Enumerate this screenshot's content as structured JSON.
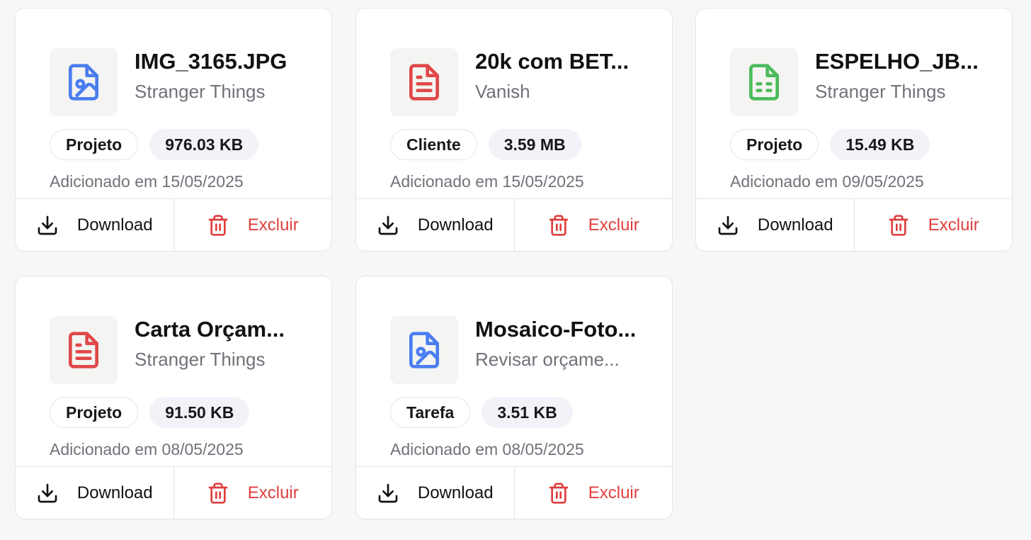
{
  "colors": {
    "image_icon": "#4a7ef0",
    "doc_icon": "#e04848",
    "sheet_icon": "#4cbb5c",
    "delete": "#e03e3e"
  },
  "labels": {
    "download": "Download",
    "delete": "Excluir"
  },
  "files": [
    {
      "icon": "image-file-icon",
      "name": "IMG_3165.JPG",
      "subtitle": "Stranger Things",
      "type": "Projeto",
      "size": "976.03 KB",
      "added": "Adicionado em 15/05/2025"
    },
    {
      "icon": "document-file-icon",
      "name": "20k com BET...",
      "subtitle": "Vanish",
      "type": "Cliente",
      "size": "3.59 MB",
      "added": "Adicionado em 15/05/2025"
    },
    {
      "icon": "spreadsheet-file-icon",
      "name": "ESPELHO_JB...",
      "subtitle": "Stranger Things",
      "type": "Projeto",
      "size": "15.49 KB",
      "added": "Adicionado em 09/05/2025"
    },
    {
      "icon": "document-file-icon",
      "name": "Carta Orçam...",
      "subtitle": "Stranger Things",
      "type": "Projeto",
      "size": "91.50 KB",
      "added": "Adicionado em 08/05/2025"
    },
    {
      "icon": "image-file-icon",
      "name": "Mosaico-Foto...",
      "subtitle": "Revisar orçame...",
      "type": "Tarefa",
      "size": "3.51 KB",
      "added": "Adicionado em 08/05/2025"
    }
  ]
}
